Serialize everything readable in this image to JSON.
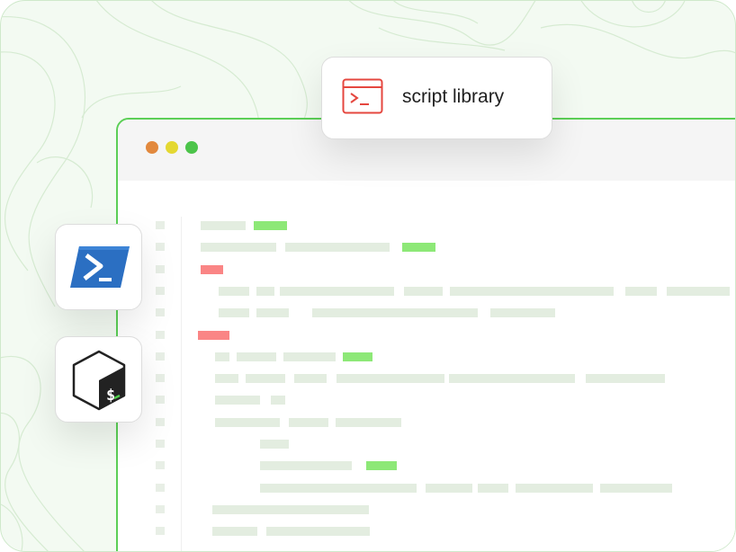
{
  "tooltip": {
    "label": "script library",
    "icon": "terminal-icon",
    "accent": "#e5473f"
  },
  "apps": [
    {
      "name": "PowerShell",
      "icon": "powershell-icon",
      "color": "#2b6fc2"
    },
    {
      "name": "Bash",
      "icon": "bash-icon",
      "color": "#222222"
    }
  ],
  "window": {
    "dots": [
      "#e2893e",
      "#e4d832",
      "#4cc44a"
    ],
    "border_color": "#5bcf56"
  },
  "diff": {
    "line_count": 15,
    "colors": {
      "added": "#8de877",
      "removed": "#fa8585",
      "unchanged": "#e3ede0"
    }
  }
}
